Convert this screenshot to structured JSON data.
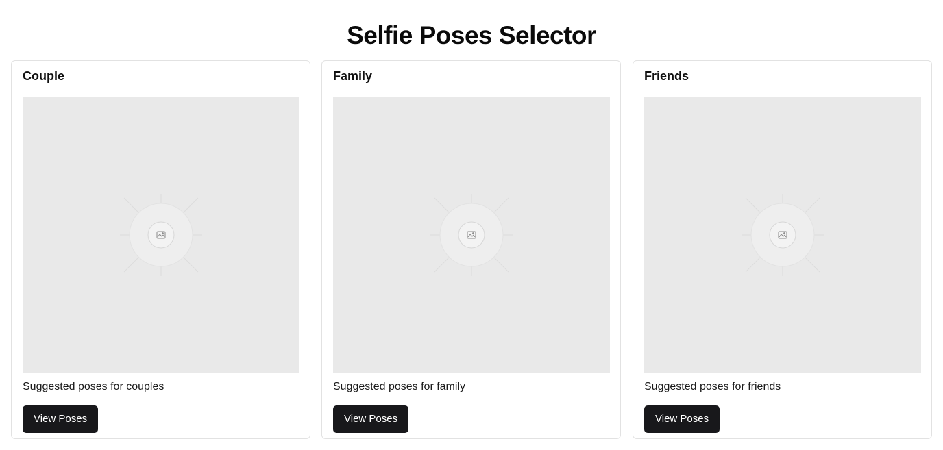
{
  "page": {
    "title": "Selfie Poses Selector"
  },
  "cards": [
    {
      "title": "Couple",
      "image_icon": "image-placeholder-icon",
      "description": "Suggested poses for couples",
      "button_label": "View Poses"
    },
    {
      "title": "Family",
      "image_icon": "image-placeholder-icon",
      "description": "Suggested poses for family",
      "button_label": "View Poses"
    },
    {
      "title": "Friends",
      "image_icon": "image-placeholder-icon",
      "description": "Suggested poses for friends",
      "button_label": "View Poses"
    }
  ],
  "colors": {
    "button_bg": "#18181b",
    "button_text": "#ffffff",
    "placeholder_bg": "#e9e9e9",
    "card_border": "#e2e2e2"
  }
}
